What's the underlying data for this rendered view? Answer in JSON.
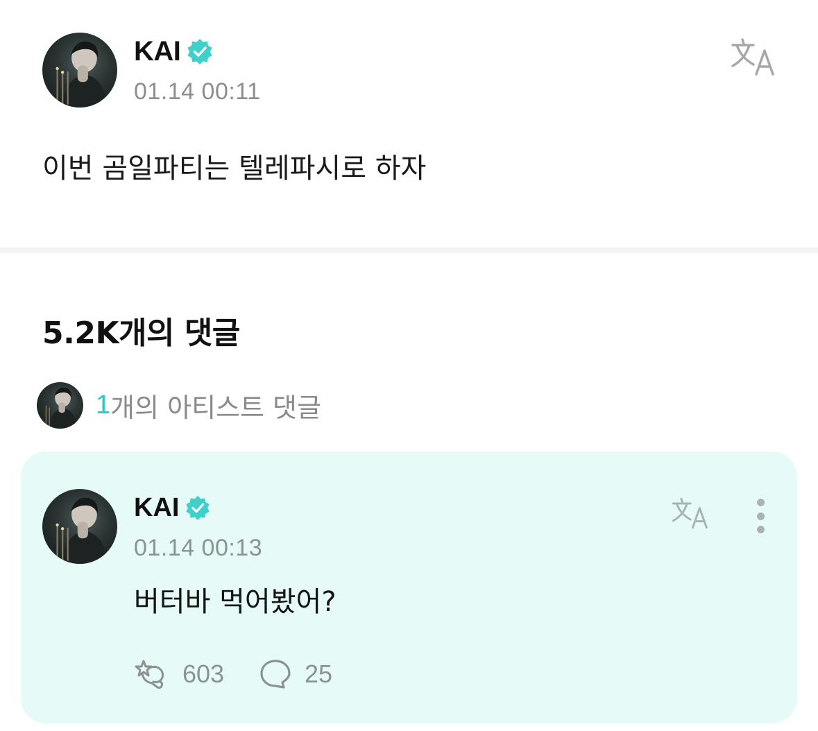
{
  "post": {
    "author": "KAI",
    "time": "01.14 00:11",
    "body": "이번 곰일파티는 텔레파시로 하자"
  },
  "comments_section": {
    "title": "5.2K개의 댓글",
    "artist_comments": {
      "count": "1",
      "label": "개의 아티스트 댓글"
    }
  },
  "comment": {
    "author": "KAI",
    "time": "01.14 00:13",
    "body": "버터바 먹어봤어?",
    "likes": "603",
    "replies": "25"
  },
  "colors": {
    "accent": "#2ec5c9",
    "card_background": "#e6fbf7",
    "verified_badge": "#3fd0c9"
  },
  "icons": [
    "verified-badge-icon",
    "translate-icon",
    "more-options-icon",
    "like-icon",
    "reply-bubble-icon"
  ]
}
